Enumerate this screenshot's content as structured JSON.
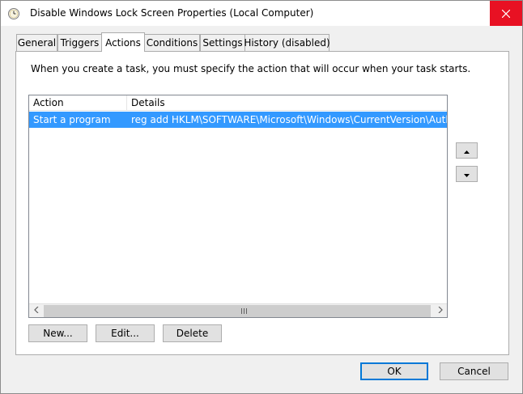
{
  "window": {
    "title": "Disable Windows Lock Screen Properties (Local Computer)"
  },
  "tabs": [
    {
      "label": "General"
    },
    {
      "label": "Triggers"
    },
    {
      "label": "Actions",
      "active": true
    },
    {
      "label": "Conditions"
    },
    {
      "label": "Settings"
    },
    {
      "label": "History (disabled)"
    }
  ],
  "actions": {
    "description": "When you create a task, you must specify the action that will occur when your task starts.",
    "columns": [
      "Action",
      "Details"
    ],
    "rows": [
      {
        "action": "Start a program",
        "details": "reg add HKLM\\SOFTWARE\\Microsoft\\Windows\\CurrentVersion\\Authentic",
        "selected": true
      }
    ],
    "new_label": "New...",
    "edit_label": "Edit...",
    "delete_label": "Delete"
  },
  "footer": {
    "ok_label": "OK",
    "cancel_label": "Cancel"
  },
  "colors": {
    "selection": "#3399ff",
    "close_hover": "#e81123"
  },
  "icons": {
    "title": "clock-icon",
    "close": "close-icon",
    "move_up": "arrow-up-icon",
    "move_down": "arrow-down-icon",
    "scroll_left": "chevron-left-icon",
    "scroll_right": "chevron-right-icon",
    "scroll_grip": "grip-icon"
  }
}
